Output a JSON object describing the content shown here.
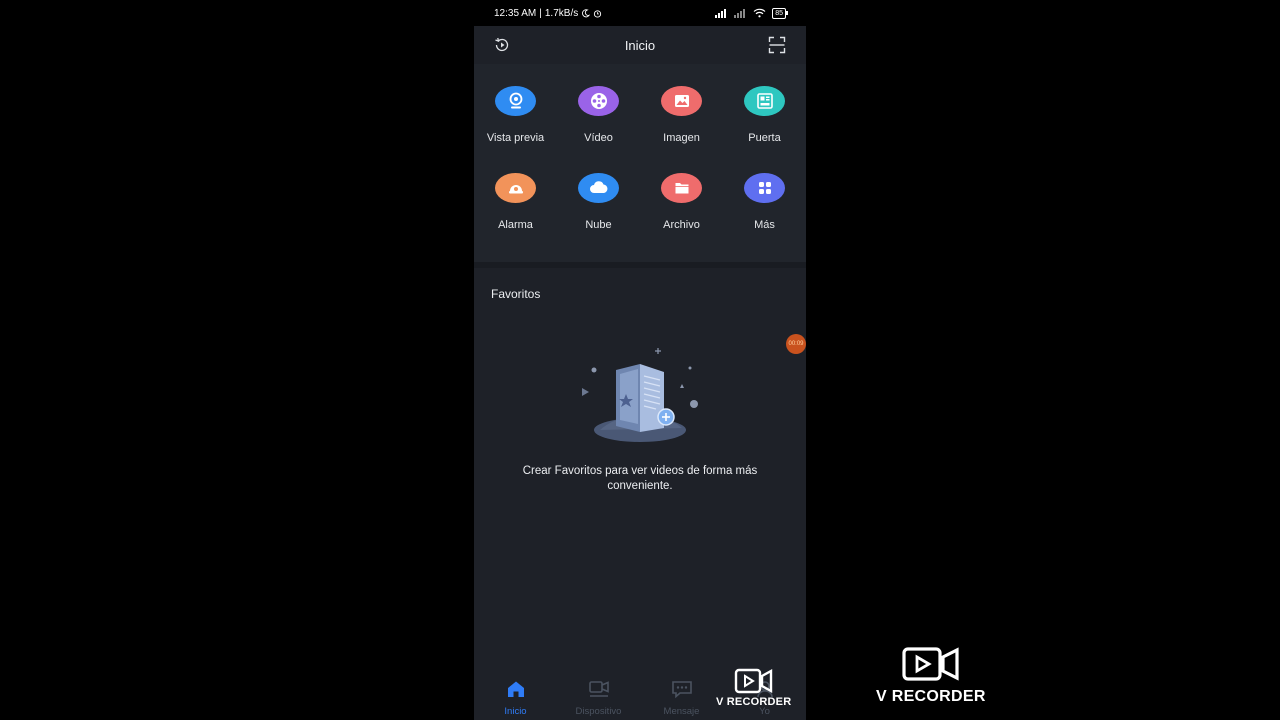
{
  "status_bar": {
    "time": "12:35 AM",
    "separator": "|",
    "speed": "1.7kB/s",
    "battery": "85"
  },
  "header": {
    "title": "Inicio",
    "history_icon": "play-history-icon",
    "scan_icon": "scan-frame-icon"
  },
  "grid": [
    {
      "label": "Vista previa",
      "icon": "camera-icon",
      "color": "#2f8cf2"
    },
    {
      "label": "Vídeo",
      "icon": "film-reel-icon",
      "color": "#9a63e8"
    },
    {
      "label": "Imagen",
      "icon": "image-icon",
      "color": "#ef6c6c"
    },
    {
      "label": "Puerta",
      "icon": "door-panel-icon",
      "color": "#2ec7c0"
    },
    {
      "label": "Alarma",
      "icon": "alarm-icon",
      "color": "#f2935a"
    },
    {
      "label": "Nube",
      "icon": "cloud-icon",
      "color": "#2f8cf2"
    },
    {
      "label": "Archivo",
      "icon": "folder-icon",
      "color": "#ef6c6c"
    },
    {
      "label": "Más",
      "icon": "grid-dots-icon",
      "color": "#5f6ff0"
    }
  ],
  "favorites": {
    "title": "Favoritos",
    "empty_message": "Crear Favoritos para ver videos de forma más conveniente."
  },
  "recording_badge": "00:09",
  "tabs": [
    {
      "label": "Inicio",
      "icon": "home-icon",
      "active": true
    },
    {
      "label": "Dispositivo",
      "icon": "device-icon",
      "active": false
    },
    {
      "label": "Mensaje",
      "icon": "message-icon",
      "active": false
    },
    {
      "label": "Yo",
      "icon": "profile-icon",
      "active": false
    }
  ],
  "watermark": "V RECORDER",
  "colors": {
    "accent": "#2f7cf6",
    "background": "#1e2128",
    "inactive": "#4b5360"
  }
}
